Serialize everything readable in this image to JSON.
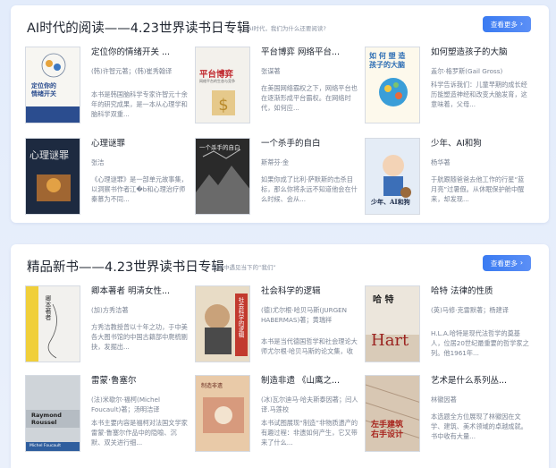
{
  "sections": [
    {
      "title": "AI时代的阅读——4.23世界读书日专辑",
      "subtitle": "AI时代，我们为什么还要阅读?",
      "more_label": "查看更多",
      "books": [
        {
          "title": "定位你的情绪开关 ...",
          "author": "(韩)许智元著；(韩)崔秀翰译",
          "desc": "本书是韩国脑科学专家许智元十余年的研究成果，是一本从心理学和脑科学双重..."
        },
        {
          "title": "平台博弈 网络平台...",
          "author": "张谋著",
          "desc": "在美国网络霸权之下，网络平台也在逐渐形成平台霸权。在网络时代，如何应..."
        },
        {
          "title": "如何塑造孩子的大脑",
          "author": "盖尔·格罗斯(Gail Gross)",
          "desc": "科学告诉我们：儿童早期的成长经历能塑造神经和改变大脑发育，这意味着，父母..."
        },
        {
          "title": "心理谜罪",
          "author": "张洁",
          "desc": "《心理谜罪》是一部单元故事集，以洞察书作者江�b和心理治疗师秦慕为不同..."
        },
        {
          "title": "一个杀手的自白",
          "author": "斯蒂芬·金",
          "desc": "如果你成了比利·萨默斯的击杀目标，那么你将永远不知道他会在什么时候、会从..."
        },
        {
          "title": "少年、AI和狗",
          "author": "杨华著",
          "desc": "于航跟随爸爸去他工作的行星“蓝月亮”过暑假。从休眠保护舱中醒来，却发现..."
        }
      ]
    },
    {
      "title": "精品新书——4.23世界读书日专辑",
      "subtitle": "在书中遇见当下的“我们”",
      "more_label": "查看更多",
      "books": [
        {
          "title": "卿本著者 明清女性...",
          "author": "(加)方秀洁著",
          "desc": "方秀洁教授曾以十年之功，于中美各大图书馆的中国古籍部中爬梳剔抉，发掘出..."
        },
        {
          "title": "社会科学的逻辑",
          "author": "(德)尤尔根·哈贝马斯(JURGEN HABERMAS)著；黄瑞祥",
          "desc": "本书是当代德国哲学和社会理论大师尤尔根·哈贝马斯的论文集，收入四篇。九篇..."
        },
        {
          "title": "哈特 法律的性质",
          "author": "(英)马修·克雷默著；杨建译",
          "desc": "H.L.A.哈特是现代法哲学的奠基人，位居20世纪最重要的哲学家之列。他1961年..."
        },
        {
          "title": "雷蒙·鲁塞尔",
          "author": "(法)米歇尔·福柯(Michel Foucault)著；汤明洁译",
          "desc": "本书主要内容是福柯对法国文学家雷蒙·鲁塞尔作品中的隐喻、沉默、双关进行细..."
        },
        {
          "title": "制造非遗 《山鹰之...",
          "author": "(冰)瓦尔迪马·哈夫斯泰因著；闫人译.马莲校",
          "desc": "本书试图展现“制造”非物质遗产的有趣过程：非遗如何产生，它又带来了什么..."
        },
        {
          "title": "艺术是什么系列丛...",
          "author": "林徽因著",
          "desc": "本选题全方位展现了林徽因在文学、建筑、美术领域的卓越成就。书中收有大量..."
        }
      ]
    }
  ],
  "covers": {
    "s0b0": {
      "line1": "定位你的",
      "line2": "情绪开关"
    },
    "s0b1": {
      "line1": "平台博弈",
      "line2": "网络平台的生态与竞争"
    },
    "s0b2": {
      "line1": "如 何 塑 造",
      "line2": "孩子的大脑"
    },
    "s0b3": {
      "line1": "心理谜罪"
    },
    "s0b4": {
      "line1": "一个杀手的自白"
    },
    "s0b5": {
      "line1": "少年、AI和狗"
    },
    "s1b0": {
      "line1": "卿本著者"
    },
    "s1b1": {
      "line1": "社会科学的逻辑"
    },
    "s1b2": {
      "line1": "哈  特",
      "line2": "Hart"
    },
    "s1b3": {
      "line1": "Raymond",
      "line2": "Roussel",
      "line3": "Michel Foucault"
    },
    "s1b4": {
      "line1": "制造非遗"
    },
    "s1b5": {
      "line1": "左手建筑",
      "line2": "右手设计"
    }
  }
}
